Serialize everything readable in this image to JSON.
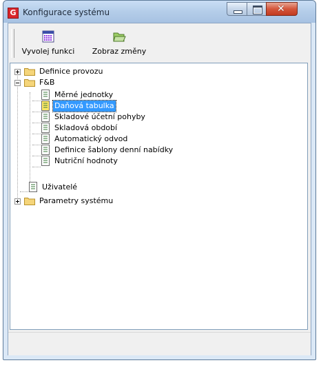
{
  "window": {
    "title": "Konfigurace systému",
    "app_icon_letter": "G"
  },
  "toolbar": {
    "invoke_label": "Vyvolej funkci",
    "show_changes_label": "Zobraz změny"
  },
  "tree": {
    "definice_provozu": "Definice provozu",
    "fb": "F&B",
    "fb_children": [
      "Měrné jednotky",
      "Daňová tabulka",
      "Skladové účetní pohyby",
      "Skladová období",
      "Automatický odvod",
      "Definice šablony denní nabídky",
      "Nutriční hodnoty"
    ],
    "uzivatele": "Uživatelé",
    "parametry": "Parametry systému",
    "selected": "Daňová tabulka"
  },
  "colors": {
    "selection": "#3399ff",
    "close_button": "#c23a1f",
    "folder": "#f5d57a"
  }
}
